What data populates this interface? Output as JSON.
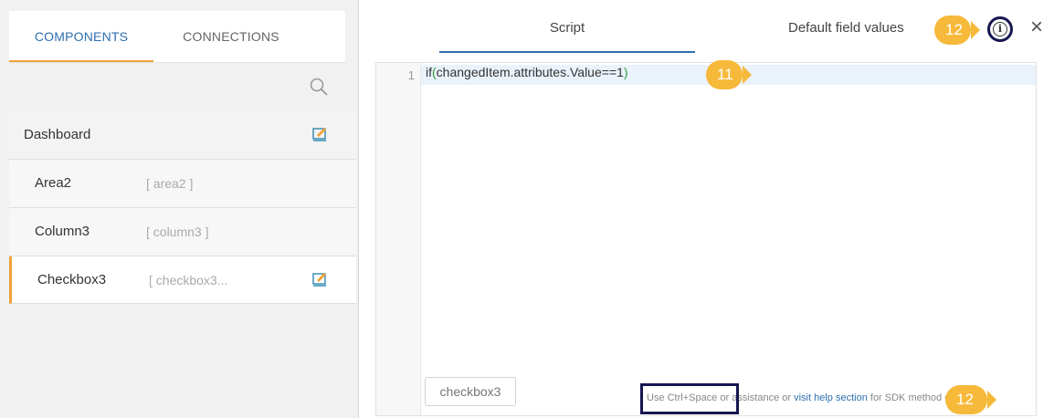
{
  "left_panel": {
    "tabs": [
      {
        "label": "COMPONENTS"
      },
      {
        "label": "CONNECTIONS"
      }
    ],
    "search_icon": "search-icon",
    "items": [
      {
        "name": "Dashboard",
        "alias": ""
      },
      {
        "name": "Area2",
        "alias": "[ area2 ]"
      },
      {
        "name": "Column3",
        "alias": "[ column3 ]"
      },
      {
        "name": "Checkbox3",
        "alias": "[ checkbox3..."
      }
    ]
  },
  "right_panel": {
    "tabs": [
      {
        "label": "Script"
      },
      {
        "label": "Default field values"
      }
    ],
    "close_symbol": "×",
    "info_symbol": "i"
  },
  "editor": {
    "line_number": "1",
    "code_prefix": "if",
    "code_open_paren": "(",
    "code_body": "changedItem.attributes.Value==1",
    "code_close_paren": ")"
  },
  "chip": {
    "label": "checkbox3"
  },
  "hint": {
    "prefix": "Use Ctrl+Space",
    "middle": " or assistance or ",
    "link": "visit help section",
    "suffix": " for SDK method details"
  },
  "annotations": {
    "badge_info": "12",
    "badge_line": "11",
    "badge_hint": "12"
  },
  "colors": {
    "accent_orange": "#f0a23a",
    "badge_yellow": "#f7b93a",
    "link_blue": "#2f6fb0",
    "annotation_navy": "#161650"
  }
}
